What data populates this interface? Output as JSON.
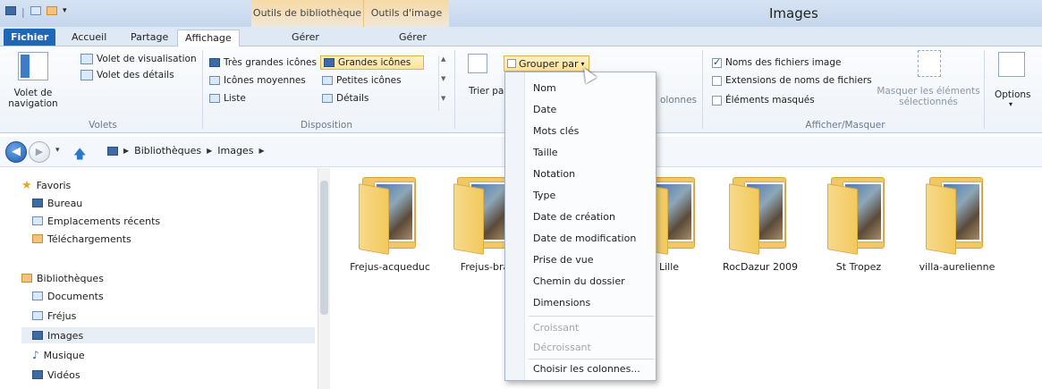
{
  "window": {
    "title": "Images"
  },
  "context_tabs": {
    "bibliotheque": "Outils de bibliothèque",
    "image": "Outils d'image"
  },
  "tabs": [
    {
      "label": "Fichier"
    },
    {
      "label": "Accueil"
    },
    {
      "label": "Partage"
    },
    {
      "label": "Affichage",
      "active": true
    },
    {
      "label": "Gérer"
    },
    {
      "label": "Gérer"
    }
  ],
  "ribbon": {
    "volets": {
      "nav_pane": "Volet de navigation",
      "preview_pane": "Volet de visualisation",
      "details_pane": "Volet des détails",
      "group_label": "Volets"
    },
    "disposition": {
      "options": [
        "Très grandes icônes",
        "Grandes icônes",
        "Icônes moyennes",
        "Petites icônes",
        "Liste",
        "Détails"
      ],
      "selected": "Grandes icônes",
      "group_label": "Disposition"
    },
    "affichage_actuel": {
      "sort": "Trier par",
      "group_by": "Grouper par",
      "columns_suffix": "olonnes"
    },
    "afficher_masquer": {
      "file_checkbox": {
        "label": "Noms des fichiers image",
        "checked": true
      },
      "ext_checkbox": {
        "label": "Extensions de noms de fichiers",
        "checked": false
      },
      "hidden_checkbox": {
        "label": "Éléments masqués",
        "checked": false
      },
      "hide_selected": "Masquer les éléments sélectionnés",
      "group_label": "Afficher/Masquer"
    },
    "options": "Options"
  },
  "address": {
    "crumbs": [
      "Bibliothèques",
      "Images"
    ]
  },
  "nav": {
    "favorites_header": "Favoris",
    "favorites": [
      "Bureau",
      "Emplacements récents",
      "Téléchargements"
    ],
    "libraries_header": "Bibliothèques",
    "libraries": [
      "Documents",
      "Fréjus",
      "Images",
      "Musique",
      "Vidéos"
    ],
    "selected": "Images"
  },
  "folders": [
    "Frejus-acqueduc",
    "Frejus-bra",
    "Lille",
    "RocDazur 2009",
    "St Tropez",
    "villa-aurelienne"
  ],
  "menu": {
    "items": [
      "Nom",
      "Date",
      "Mots clés",
      "Taille",
      "Notation",
      "Type",
      "Date de création",
      "Date de modification",
      "Prise de vue",
      "Chemin du dossier",
      "Dimensions"
    ],
    "disabled_items": [
      "Croissant",
      "Décroissant"
    ],
    "footer_item": "Choisir les colonnes..."
  },
  "colors": {
    "accent": "#1f66b5",
    "folder": "#f0c964",
    "highlight": "#fde29a"
  }
}
